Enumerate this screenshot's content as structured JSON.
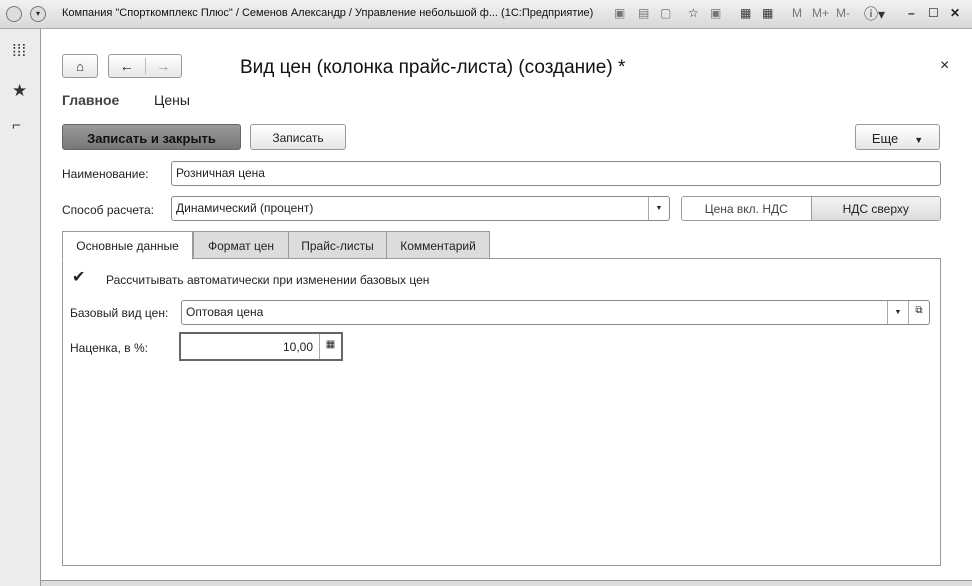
{
  "window": {
    "title": "Компания \"Спорткомплекс Плюс\" / Семенов Александр / Управление небольшой ф...  (1С:Предприятие)",
    "toolbar_icons": [
      "save-icon",
      "print-icon",
      "preview-icon",
      "favorites-icon",
      "bookmark-icon",
      "calculator-icon",
      "calendar-icon",
      "info-icon"
    ],
    "m": "M",
    "mplus": "M+",
    "mminus": "M-",
    "minimize": "–",
    "maximize": "☐",
    "close": "✕"
  },
  "sidebar": {
    "icons": [
      "apps-grid-icon",
      "star-icon",
      "history-icon"
    ]
  },
  "form": {
    "title": "Вид цен (колонка прайс-листа) (создание) *",
    "close": "×",
    "nav_tabs": [
      "Главное",
      "Цены"
    ],
    "buttons": {
      "save_close": "Записать и закрыть",
      "save": "Записать",
      "more": "Еще"
    },
    "name_label": "Наименование:",
    "name_value": "Розничная цена",
    "method_label": "Способ расчета:",
    "method_value": "Динамический (процент)",
    "vat_toggle": [
      "Цена вкл. НДС",
      "НДС сверху"
    ],
    "vat_selected": "НДС сверху",
    "tabs": [
      "Основные данные",
      "Формат цен",
      "Прайс-листы",
      "Комментарий"
    ],
    "active_tab": "Основные данные",
    "auto_calc_label": "Рассчитывать автоматически при изменении базовых цен",
    "auto_calc_checked": true,
    "base_label": "Базовый вид цен:",
    "base_value": "Оптовая цена",
    "markup_label": "Наценка, в %:",
    "markup_value": "10,00"
  }
}
